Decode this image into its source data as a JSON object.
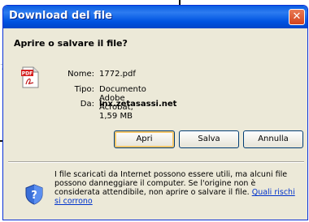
{
  "dialog": {
    "title": "Download del file",
    "close_glyph": "✕",
    "heading": "Aprire o salvare il file?"
  },
  "file_info": {
    "name_label": "Nome:",
    "name_value": "1772.pdf",
    "type_label": "Tipo:",
    "type_value": "Documento Adobe Acrobat, 1,59 MB",
    "from_label": "Da:",
    "from_value": "lnx.zetasassi.net",
    "icon_badge": "PDF"
  },
  "buttons": {
    "open": "Apri",
    "save": "Salva",
    "cancel": "Annulla"
  },
  "warning": {
    "text": "I file scaricati da Internet possono essere utili, ma alcuni file possono danneggiare il computer. Se l'origine non è considerata attendibile, non aprire o salvare il file.",
    "link": "Quali rischi si corrono"
  },
  "background": {
    "edge_mark": "7"
  },
  "colors": {
    "titlebar": "#0a5ce0",
    "dialog_bg": "#ece9d8",
    "close": "#d3431d",
    "link": "#0033cc"
  },
  "icons": [
    "pdf-file-icon",
    "close-icon",
    "security-shield-icon"
  ]
}
